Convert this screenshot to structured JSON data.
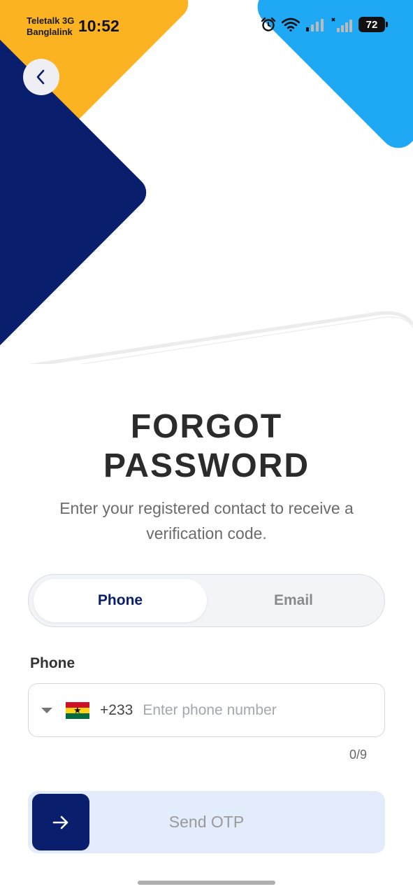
{
  "status_bar": {
    "carrier_line1": "Teletalk 3G",
    "carrier_line2": "Banglalink",
    "time": "10:52",
    "battery": "72",
    "icons": [
      "alarm-icon",
      "wifi-icon",
      "signal-icon",
      "signal-icon"
    ]
  },
  "nav": {
    "back_icon": "chevron-left-icon"
  },
  "header": {
    "title_line1": "FORGOT",
    "title_line2": "PASSWORD",
    "subtitle": "Enter your registered contact to receive a verification code."
  },
  "tabs": [
    {
      "label": "Phone",
      "active": true
    },
    {
      "label": "Email",
      "active": false
    }
  ],
  "form": {
    "phone_label": "Phone",
    "country_flag": "ghana-flag",
    "dial_code": "+233",
    "phone_value": "",
    "phone_placeholder": "Enter phone number",
    "char_counter": "0/9"
  },
  "actions": {
    "send_otp_label": "Send OTP",
    "send_icon": "arrow-right-icon"
  },
  "colors": {
    "navy": "#0A1E6E",
    "yellow": "#FBB321",
    "sky_blue": "#1FA9F5",
    "button_bg": "#E3ECFB"
  }
}
